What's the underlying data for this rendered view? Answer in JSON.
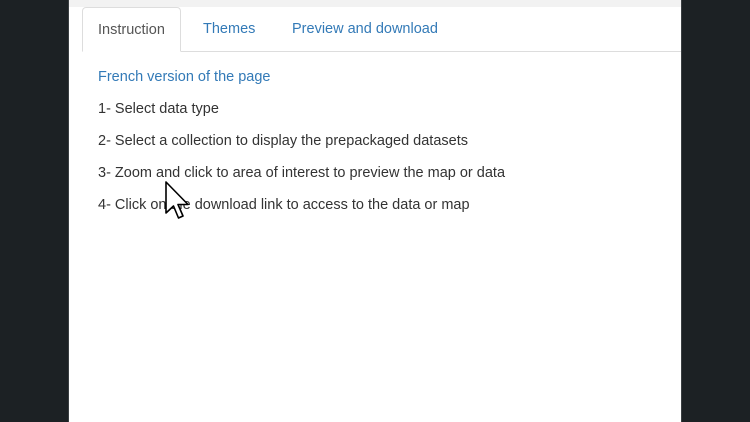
{
  "tabs": [
    {
      "label": "Instruction",
      "active": true
    },
    {
      "label": "Themes",
      "active": false
    },
    {
      "label": "Preview and download",
      "active": false
    }
  ],
  "content": {
    "french_link": "French version of the page",
    "steps": [
      "1- Select data type",
      "2- Select a collection to display the prepackaged datasets",
      "3- Zoom and click to area of interest to preview the map or data",
      "4- Click on the download link to access to the data or map"
    ]
  },
  "colors": {
    "link": "#337ab7",
    "text": "#333333",
    "background_frame": "#1c2124"
  },
  "icons": {
    "cursor": "mouse-pointer-icon"
  }
}
